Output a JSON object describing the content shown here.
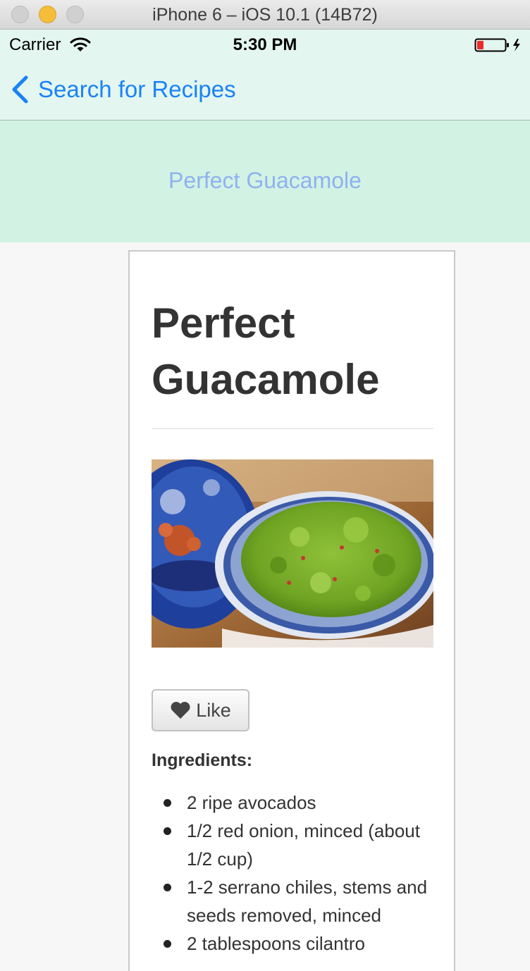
{
  "window": {
    "title": "iPhone 6 – iOS 10.1 (14B72)"
  },
  "status_bar": {
    "carrier": "Carrier",
    "time": "5:30 PM"
  },
  "nav": {
    "back_label": "Search for Recipes"
  },
  "banner": {
    "title": "Perfect Guacamole"
  },
  "recipe": {
    "heading": "Perfect Guacamole",
    "like_label": "Like",
    "ingredients_heading": "Ingredients:",
    "ingredients": [
      "2 ripe avocados",
      "1/2 red onion, minced (about 1/2 cup)",
      "1-2 serrano chiles, stems and seeds removed, minced",
      "2 tablespoons cilantro"
    ]
  },
  "colors": {
    "nav_background": "#e3f6ef",
    "banner_background": "#d2f2e4",
    "link_blue": "#1a82f6",
    "banner_title": "#8fb2ef"
  }
}
